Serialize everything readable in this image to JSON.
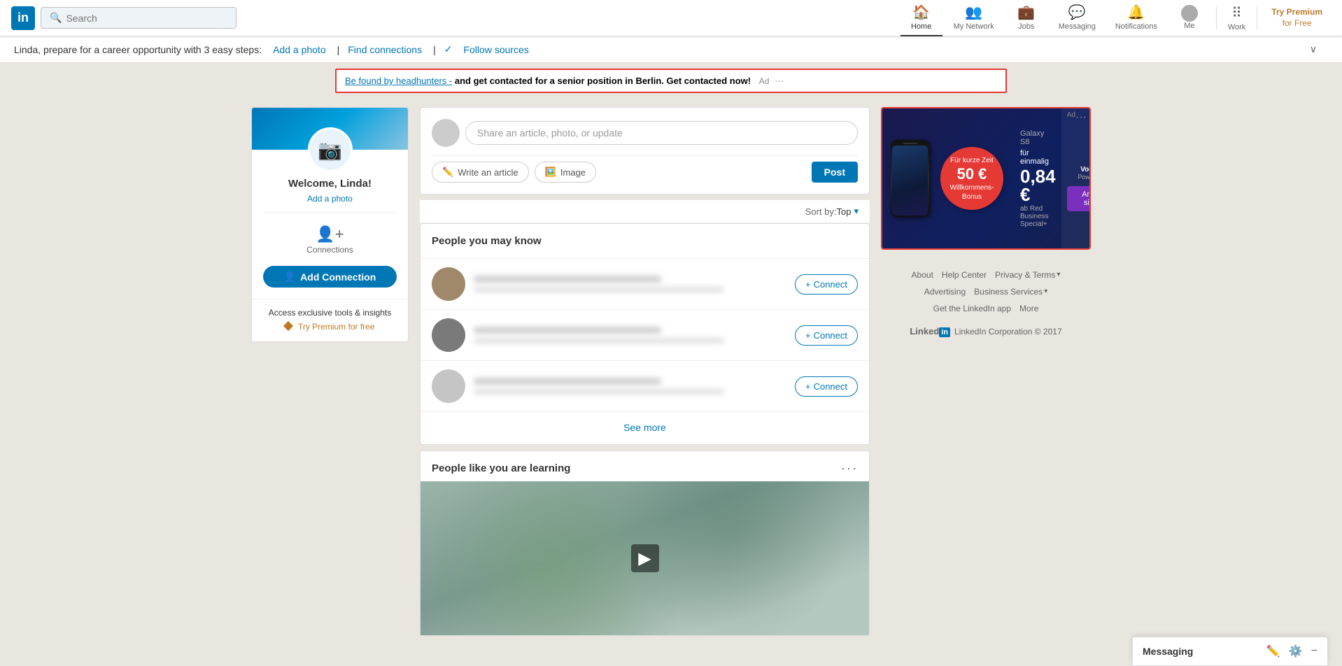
{
  "app": {
    "logo": "in",
    "search_placeholder": "Search"
  },
  "navbar": {
    "items": [
      {
        "id": "home",
        "label": "Home",
        "icon": "🏠",
        "active": true
      },
      {
        "id": "my-network",
        "label": "My Network",
        "icon": "👥",
        "active": false
      },
      {
        "id": "jobs",
        "label": "Jobs",
        "icon": "💼",
        "active": false
      },
      {
        "id": "messaging",
        "label": "Messaging",
        "icon": "💬",
        "active": false
      },
      {
        "id": "notifications",
        "label": "Notifications",
        "icon": "🔔",
        "active": false
      },
      {
        "id": "me",
        "label": "Me",
        "icon": "👤",
        "active": false
      }
    ],
    "work_label": "Work",
    "premium_line1": "Try Premium",
    "premium_line2": "for Free"
  },
  "career_banner": {
    "text": "Linda, prepare for a career opportunity with 3 easy steps:",
    "links": [
      {
        "label": "Add a photo"
      },
      {
        "label": "Find connections"
      },
      {
        "label": "Follow sources",
        "check": true
      }
    ]
  },
  "ad_banner": {
    "link_text": "Be found by headhunters -",
    "text": " and get contacted for a senior position in Berlin. Get contacted now!",
    "ad_label": "Ad"
  },
  "profile_card": {
    "welcome": "Welcome, Linda!",
    "add_photo": "Add a photo",
    "connections_label": "Connections",
    "add_connection_label": "Add Connection",
    "premium_text": "Access exclusive tools & insights",
    "premium_link": "Try Premium for free"
  },
  "post_card": {
    "placeholder": "Share an article, photo, or update",
    "write_article": "Write an article",
    "image_label": "Image",
    "post_label": "Post",
    "sort_label": "Sort by:",
    "sort_value": "Top"
  },
  "people_section": {
    "title": "People you may know",
    "connect_label": "+ Connect",
    "see_more": "See more",
    "people": [
      {
        "id": 1,
        "avatar_color": "#a0896b"
      },
      {
        "id": 2,
        "avatar_color": "#7a7a7a"
      },
      {
        "id": 3,
        "avatar_color": "#c5c5c5"
      }
    ]
  },
  "learning_section": {
    "title": "People like you are learning",
    "dots_label": "···"
  },
  "footer": {
    "links": [
      "About",
      "Help Center",
      "Privacy & Terms",
      "Advertising",
      "Business Services",
      "Get the LinkedIn app",
      "More"
    ],
    "copyright": "LinkedIn Corporation © 2017"
  },
  "vodafone_ad": {
    "sponsored": "Ad",
    "title_line1": "50 €",
    "title_line2": "Willkommens-",
    "title_line3": "Bonus",
    "subtitle": "Galaxy S8",
    "price": "0,84 €",
    "price_sub": "ab Red Business Special+",
    "brand": "Vodafone",
    "tagline": "Power to you",
    "cta": "Angebot sichern"
  },
  "messaging_bar": {
    "label": "Messaging"
  }
}
